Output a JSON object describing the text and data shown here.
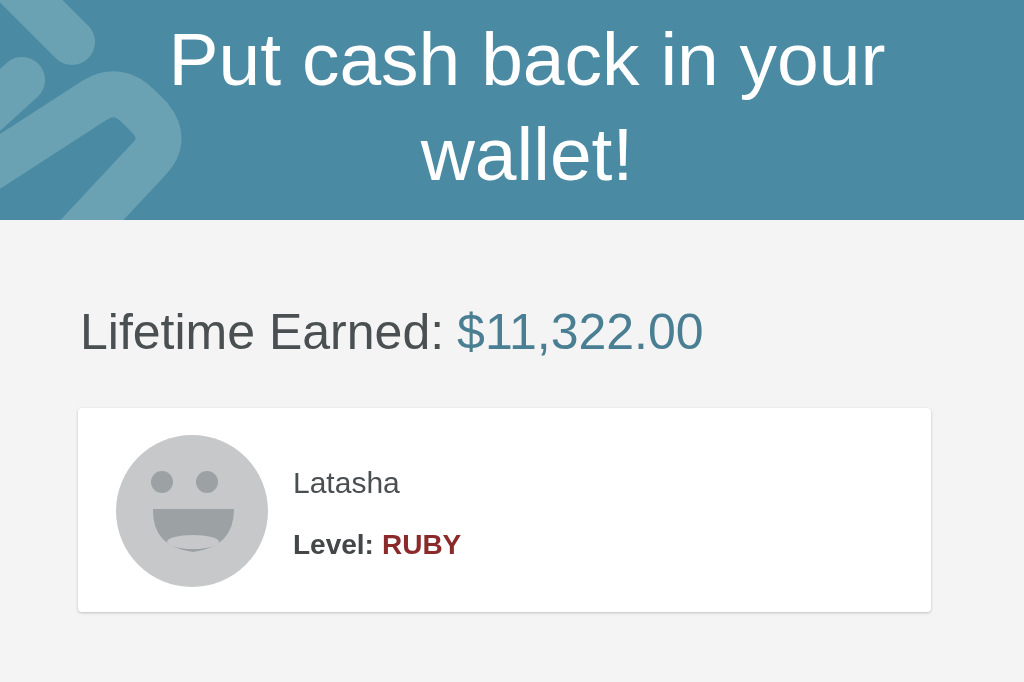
{
  "header": {
    "title": "Put cash back in your wallet!"
  },
  "summary": {
    "label": "Lifetime Earned:",
    "amount": "$11,322.00"
  },
  "profile": {
    "name": "Latasha",
    "rank_label": "Level:",
    "rank": "RUBY"
  }
}
